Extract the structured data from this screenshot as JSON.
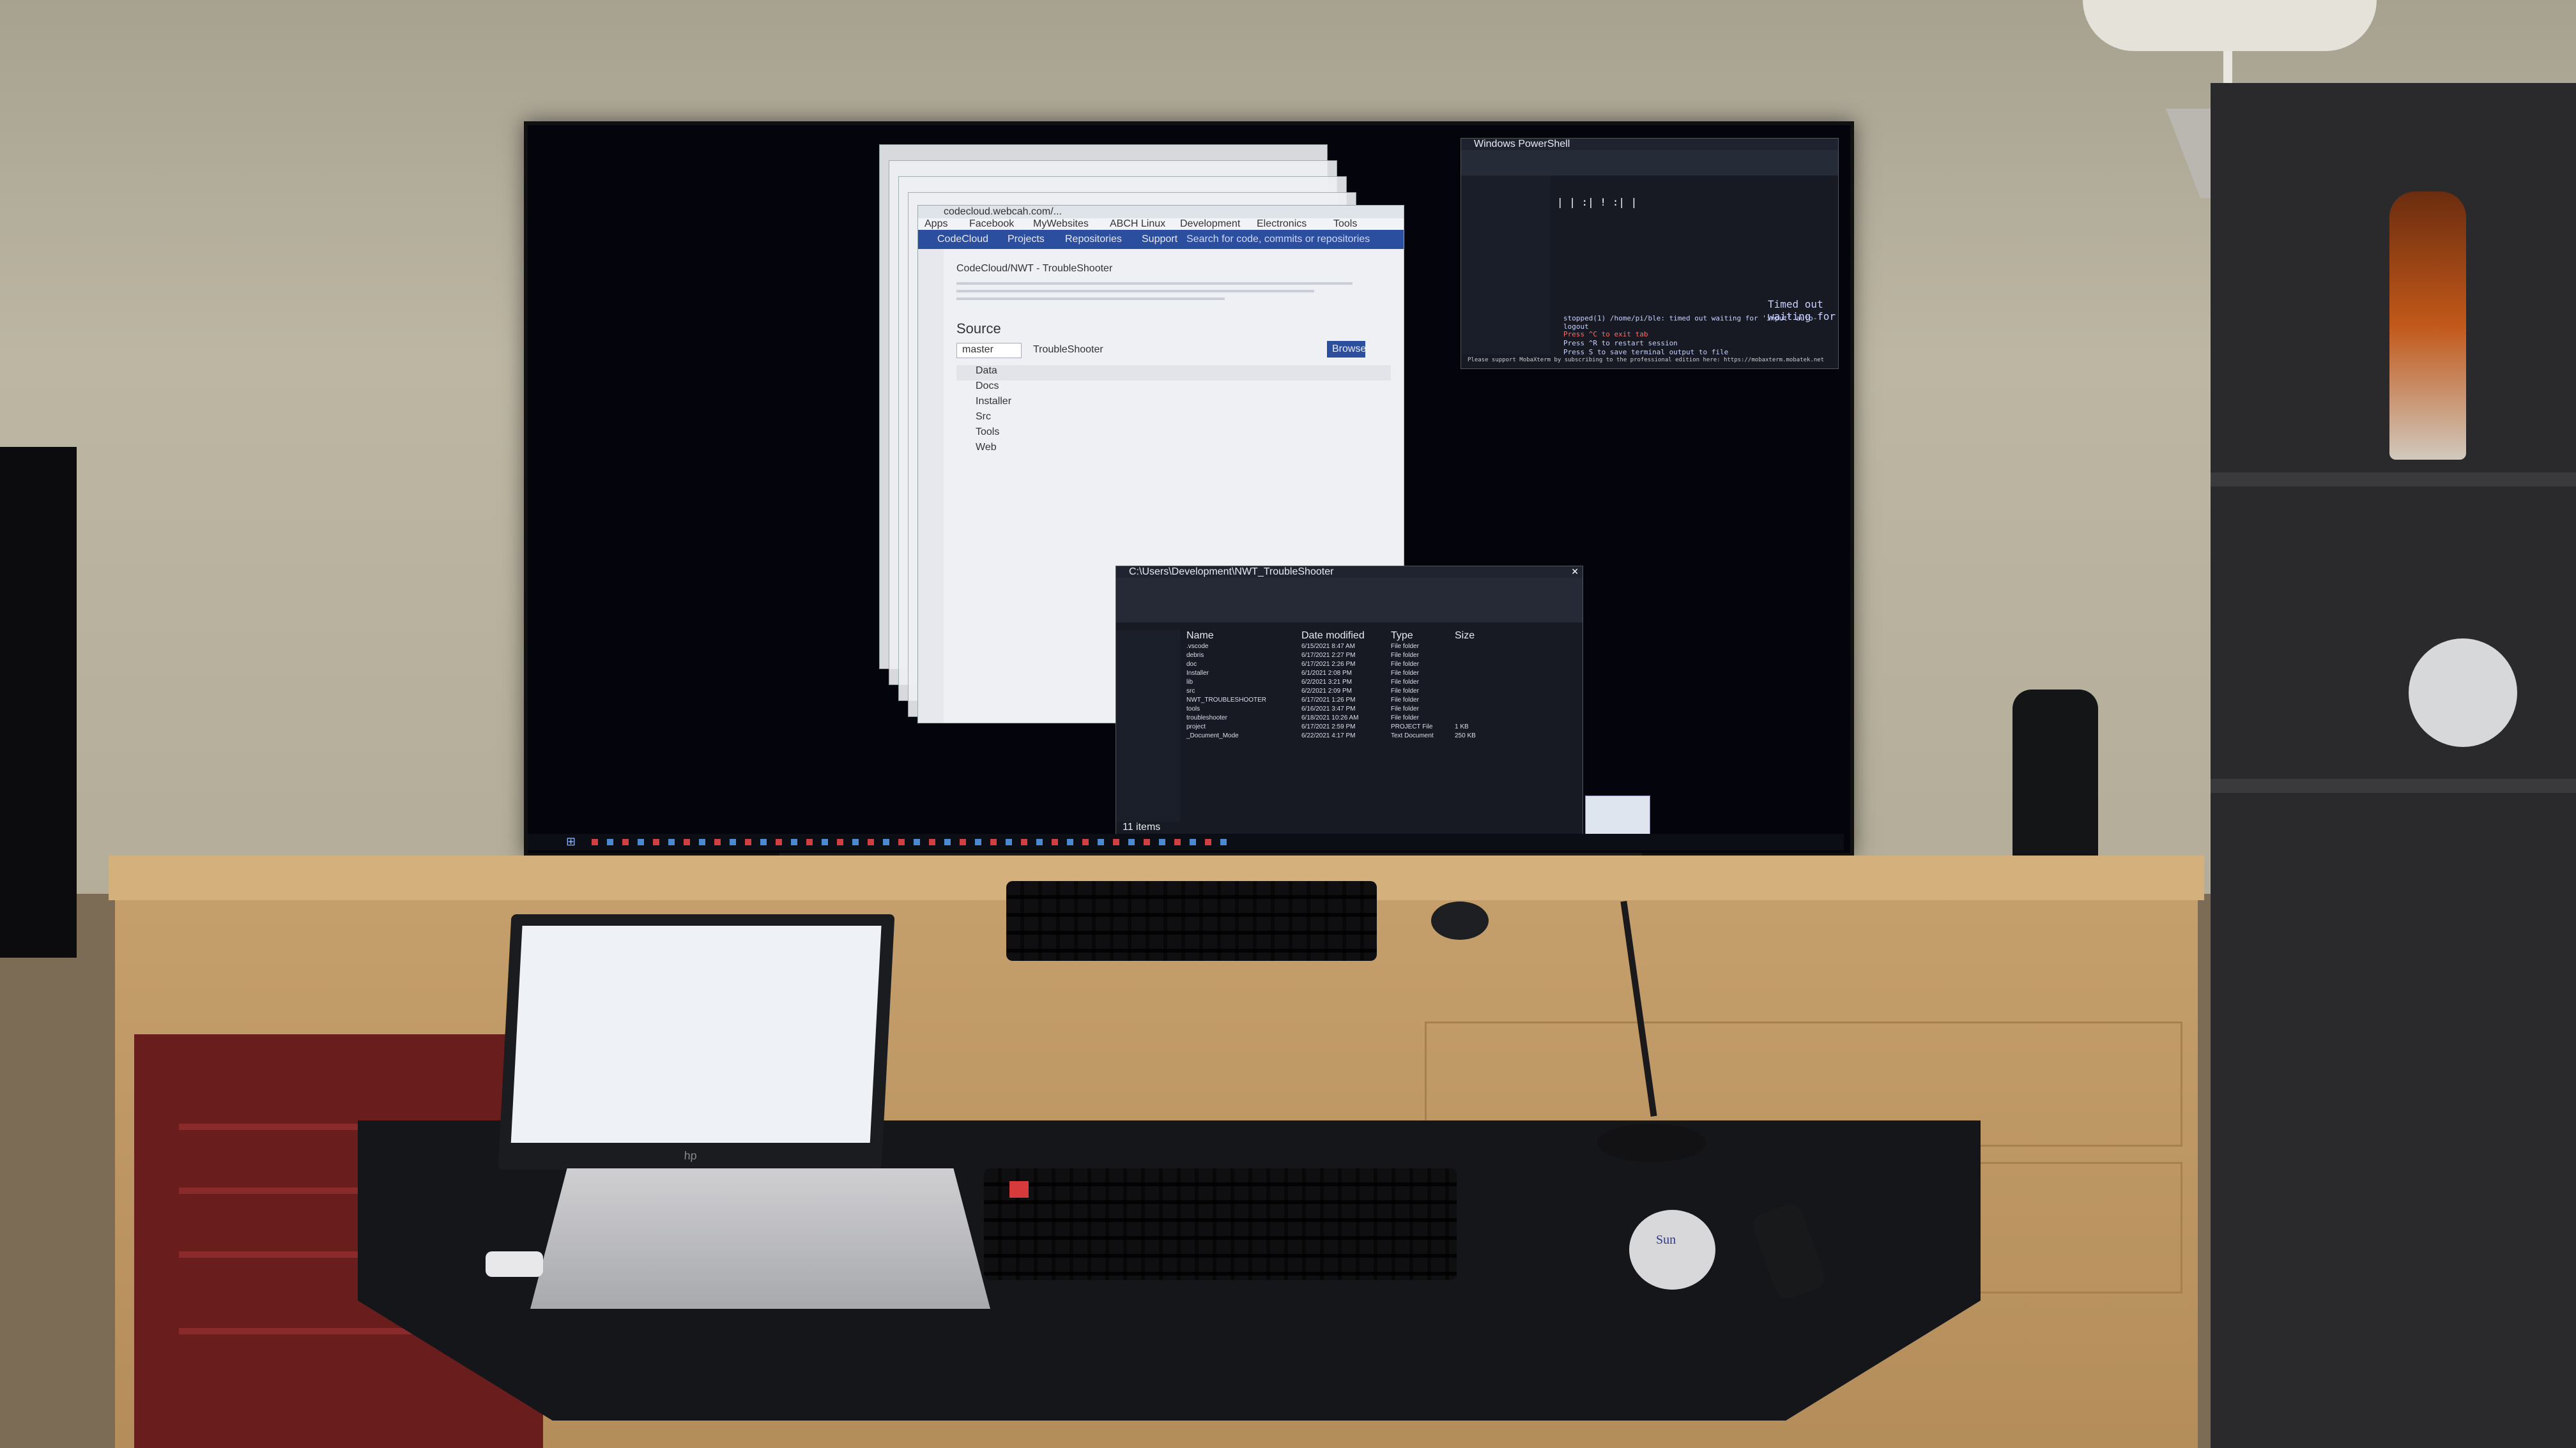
{
  "scene": {
    "description_tags": [
      "home-desk-setup",
      "large-monitor",
      "laptop",
      "keyboards"
    ]
  },
  "monitor": {
    "browser": {
      "url": "codecloud.webcah.com/...",
      "bookmarks": [
        "Apps",
        "Facebook",
        "MyWebsites",
        "ABCH Linux",
        "Development",
        "Electronics",
        "Tools"
      ],
      "nav": [
        "CodeCloud",
        "Projects",
        "Repositories",
        "Support"
      ],
      "search_placeholder": "Search for code, commits or repositories",
      "repo_title": "CodeCloud/NWT - TroubleShooter",
      "section": "Source",
      "branch": "master",
      "path": "TroubleShooter",
      "clone_button": "Browse",
      "folders": [
        "Data",
        "Docs",
        "Installer",
        "Src",
        "Tools",
        "Web"
      ]
    },
    "terminal": {
      "title": "Windows PowerShell",
      "status_lines": [
        "Timed out waiting for",
        "stopped(1) /home/pi/ble: timed out waiting for 'input' auto-logout",
        "Press ^C to exit tab",
        "Press ^R to restart session",
        "Press S to save terminal output to file"
      ],
      "footer": "Please support MobaXterm by subscribing to the professional edition here: https://mobaxterm.mobatek.net"
    },
    "explorer": {
      "title": "C:\\Users\\Development\\NWT_TroubleShooter",
      "columns": [
        "Name",
        "Date modified",
        "Type",
        "Size"
      ],
      "rows": [
        {
          "name": ".vscode",
          "date": "6/15/2021 8:47 AM",
          "type": "File folder",
          "size": ""
        },
        {
          "name": "debris",
          "date": "6/17/2021 2:27 PM",
          "type": "File folder",
          "size": ""
        },
        {
          "name": "doc",
          "date": "6/17/2021 2:26 PM",
          "type": "File folder",
          "size": ""
        },
        {
          "name": "Installer",
          "date": "6/1/2021 2:08 PM",
          "type": "File folder",
          "size": ""
        },
        {
          "name": "lib",
          "date": "6/2/2021 3:21 PM",
          "type": "File folder",
          "size": ""
        },
        {
          "name": "src",
          "date": "6/2/2021 2:09 PM",
          "type": "File folder",
          "size": ""
        },
        {
          "name": "NWT_TROUBLESHOOTER",
          "date": "6/17/2021 1:26 PM",
          "type": "File folder",
          "size": ""
        },
        {
          "name": "tools",
          "date": "6/16/2021 3:47 PM",
          "type": "File folder",
          "size": ""
        },
        {
          "name": "troubleshooter",
          "date": "6/18/2021 10:26 AM",
          "type": "File folder",
          "size": ""
        },
        {
          "name": "project",
          "date": "6/17/2021 2:59 PM",
          "type": "PROJECT File",
          "size": "1 KB"
        },
        {
          "name": "_Document_Mode",
          "date": "6/22/2021 4:17 PM",
          "type": "Text Document",
          "size": "250 KB"
        }
      ],
      "status": "11 items"
    }
  },
  "laptop": {
    "brand": "hp"
  },
  "mouse": {
    "brand": "Sun"
  }
}
